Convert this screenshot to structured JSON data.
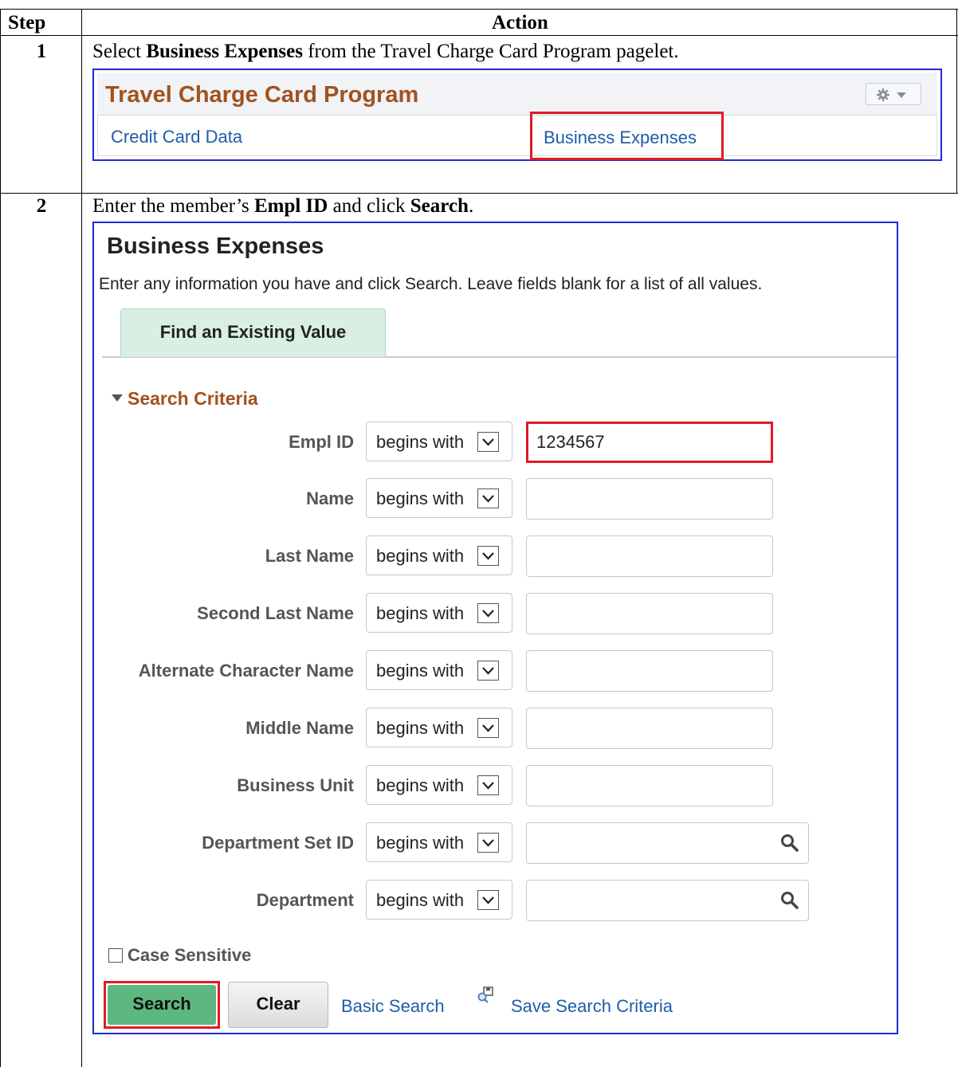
{
  "table": {
    "header_step": "Step",
    "header_action": "Action",
    "steps": [
      {
        "number": "1",
        "instruction_pre": "Select ",
        "instruction_bold": "Business Expenses",
        "instruction_post": " from the Travel Charge Card Program pagelet."
      },
      {
        "number": "2",
        "instruction_pre": "Enter the member’s ",
        "instruction_bold1": "Empl ID",
        "instruction_mid": " and click ",
        "instruction_bold2": "Search",
        "instruction_post": "."
      }
    ]
  },
  "pagelet": {
    "title": "Travel Charge Card Program",
    "links": [
      "Credit Card Data",
      "Business Expenses"
    ],
    "settings_icon": "gear-icon"
  },
  "search_page": {
    "title": "Business Expenses",
    "instructions": "Enter any information you have and click Search. Leave fields blank for a list of all values.",
    "tab_label": "Find an Existing Value",
    "section_title": "Search Criteria",
    "fields": [
      {
        "label": "Empl ID",
        "operator": "begins with",
        "value": "1234567"
      },
      {
        "label": "Name",
        "operator": "begins with",
        "value": ""
      },
      {
        "label": "Last Name",
        "operator": "begins with",
        "value": ""
      },
      {
        "label": "Second Last Name",
        "operator": "begins with",
        "value": ""
      },
      {
        "label": "Alternate Character Name",
        "operator": "begins with",
        "value": ""
      },
      {
        "label": "Middle Name",
        "operator": "begins with",
        "value": ""
      },
      {
        "label": "Business Unit",
        "operator": "begins with",
        "value": ""
      },
      {
        "label": "Department Set ID",
        "operator": "begins with",
        "value": ""
      },
      {
        "label": "Department",
        "operator": "begins with",
        "value": ""
      }
    ],
    "case_sensitive_label": "Case Sensitive",
    "case_sensitive_checked": false,
    "buttons": {
      "search": "Search",
      "clear": "Clear"
    },
    "links": {
      "basic_search": "Basic Search",
      "save_criteria": "Save Search Criteria"
    }
  },
  "colors": {
    "highlight": "#e01b24",
    "frame_border": "#1f2bd6",
    "title_brown": "#a1521e",
    "link_blue": "#1f5da8",
    "search_button": "#5cb87f",
    "tab_fill": "#d9efe3"
  }
}
